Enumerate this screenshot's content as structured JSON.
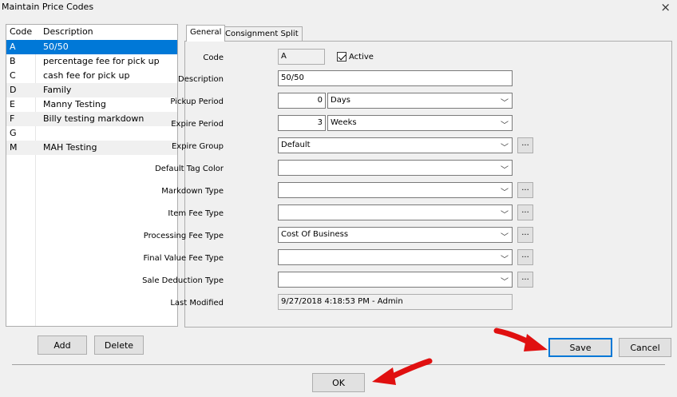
{
  "window": {
    "title": "Maintain Price Codes",
    "close_glyph": "×"
  },
  "list": {
    "headers": {
      "code": "Code",
      "description": "Description"
    },
    "rows": [
      {
        "code": "A",
        "description": "50/50"
      },
      {
        "code": "B",
        "description": "percentage fee for pick up"
      },
      {
        "code": "C",
        "description": "cash fee for pick up"
      },
      {
        "code": "D",
        "description": "Family"
      },
      {
        "code": "E",
        "description": "Manny Testing"
      },
      {
        "code": "F",
        "description": "Billy testing markdown"
      },
      {
        "code": "G",
        "description": ""
      },
      {
        "code": "M",
        "description": "MAH Testing"
      }
    ],
    "selected_index": 0
  },
  "tabs": [
    {
      "label": "General"
    },
    {
      "label": "Consignment Split"
    }
  ],
  "form": {
    "code": {
      "label": "Code",
      "value": "A"
    },
    "active": {
      "label": "Active",
      "checked": true
    },
    "description": {
      "label": "Description",
      "value": "50/50"
    },
    "pickup_period": {
      "label": "Pickup Period",
      "value": "0",
      "unit": "Days"
    },
    "expire_period": {
      "label": "Expire Period",
      "value": "3",
      "unit": "Weeks"
    },
    "expire_group": {
      "label": "Expire Group",
      "value": "Default"
    },
    "default_tag_color": {
      "label": "Default Tag Color",
      "value": ""
    },
    "markdown_type": {
      "label": "Markdown Type",
      "value": ""
    },
    "item_fee_type": {
      "label": "Item Fee Type",
      "value": ""
    },
    "processing_fee_type": {
      "label": "Processing Fee Type",
      "value": "Cost Of Business"
    },
    "final_value_fee_type": {
      "label": "Final Value Fee Type",
      "value": ""
    },
    "sale_deduction_type": {
      "label": "Sale Deduction Type",
      "value": ""
    },
    "last_modified": {
      "label": "Last Modified",
      "value": "9/27/2018 4:18:53 PM - Admin"
    },
    "ellipsis": "...",
    "chevron": "﹀"
  },
  "buttons": {
    "add": "Add",
    "delete": "Delete",
    "save": "Save",
    "cancel": "Cancel",
    "ok": "OK"
  },
  "colors": {
    "selection": "#0078d7",
    "arrow": "#e01010"
  }
}
